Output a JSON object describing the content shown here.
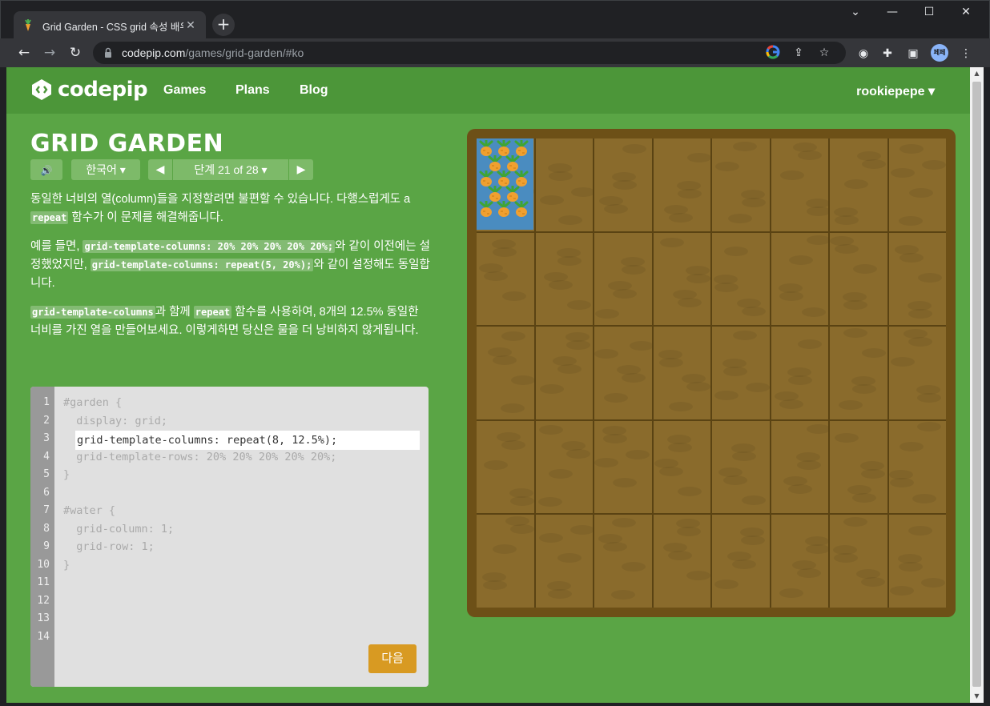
{
  "browser": {
    "tab_title": "Grid Garden - CSS grid 속성 배우기",
    "tab_close": "✕",
    "new_tab": "+",
    "window": {
      "minimize": "⌄",
      "restore": "—",
      "maximize": "☐",
      "close": "✕"
    },
    "url_host": "codepip.com",
    "url_path": "/games/grid-garden/#ko",
    "avatar_text": "페페"
  },
  "site": {
    "logo_text": "codepip",
    "nav": {
      "games": "Games",
      "plans": "Plans",
      "blog": "Blog"
    },
    "user": "rookiepepe ▾"
  },
  "game": {
    "title": "GRID GARDEN",
    "sound_icon": "🔊",
    "language": "한국어 ▾",
    "prev": "◀",
    "next": "▶",
    "level_label": "단계 21 of 28 ▾",
    "current_level": 21,
    "total_levels": 28
  },
  "instructions": {
    "p1_a": "동일한 너비의 열(column)들을 지정할려면 불편할 수 있습니다. 다행스럽게도 a ",
    "p1_code": "repeat",
    "p1_b": " 함수가 이 문제를 해결해줍니다.",
    "p2_a": "예를 들면, ",
    "p2_code1": "grid-template-columns: 20% 20% 20% 20% 20%;",
    "p2_b": "와 같이 이전에는 설정했었지만, ",
    "p2_code2": "grid-template-columns: repeat(5, 20%);",
    "p2_c": "와 같이 설정해도 동일합니다.",
    "p3_code1": "grid-template-columns",
    "p3_a": "과 함께 ",
    "p3_code2": "repeat",
    "p3_b": " 함수를 사용하여, 8개의 12.5% 동일한 너비를 가진 열을 만들어보세요. 이렇게하면 당신은 물을 더 낭비하지 않게됩니다."
  },
  "editor": {
    "line_numbers": [
      "1",
      "2",
      "3",
      "4",
      "5",
      "6",
      "7",
      "8",
      "9",
      "10",
      "11",
      "12",
      "13",
      "14"
    ],
    "lines": [
      "#garden {",
      "  display: grid;",
      "",
      "  grid-template-rows: 20% 20% 20% 20% 20%;",
      "}",
      "",
      "#water {",
      "  grid-column: 1;",
      "  grid-row: 1;",
      "}"
    ],
    "input_value": "grid-template-columns: repeat(8, 12.5%);",
    "next_button": "다음"
  },
  "garden": {
    "columns": 8,
    "rows": 5,
    "water_area": "grid-column: 1; grid-row: 1",
    "soil_color": "#8a6b2c",
    "water_color": "#4a8cc0",
    "border_color": "#6d5017"
  },
  "colors": {
    "page_bg": "#5aa545",
    "nav_bg": "#4c9639",
    "button_bg": "#7dba69",
    "next_button_bg": "#d89a22"
  }
}
